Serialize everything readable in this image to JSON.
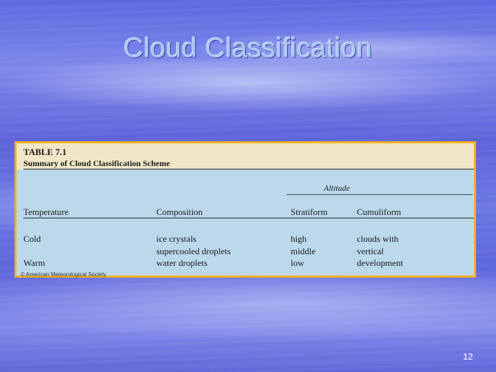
{
  "slide": {
    "title": "Cloud Classification",
    "page_number": "12"
  },
  "table": {
    "number": "TABLE 7.1",
    "caption": "Summary of Cloud Classification Scheme",
    "group_header": "Altitude",
    "columns": [
      "Temperature",
      "Composition",
      "Stratiform",
      "Cumuliform"
    ],
    "rows": [
      [
        "Cold",
        "ice crystals",
        "high",
        "clouds with"
      ],
      [
        "",
        "supercooled droplets",
        "middle",
        "vertical"
      ],
      [
        "Warm",
        "water droplets",
        "low",
        "development"
      ]
    ],
    "credit": "© American Meteorological Society"
  },
  "colors": {
    "frame_border": "#f2b21a",
    "table_background": "#bcd9ec",
    "header_background": "#f1e6c6",
    "title_color": "#a9c8f0"
  }
}
